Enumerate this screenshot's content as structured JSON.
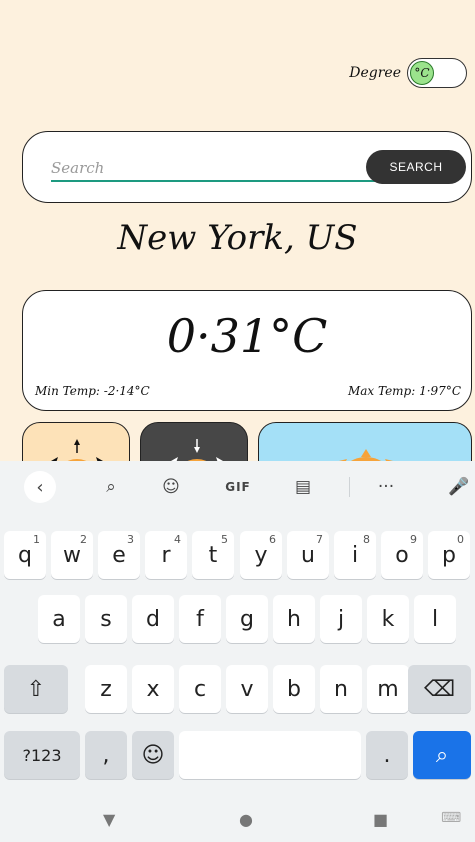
{
  "degree": {
    "label": "Degree",
    "unit": "°C"
  },
  "search": {
    "placeholder": "Search",
    "value": "",
    "button": "SEARCH"
  },
  "city": "New York, US",
  "temperature": {
    "current": "0·31°C",
    "min": "Min Temp: -2·14°C",
    "max": "Max Temp: 1·97°C"
  },
  "keyboard": {
    "toolbar": {
      "back": "‹",
      "search": "⌕",
      "sticker": "☺",
      "gif": "GIF",
      "clipboard": "▤",
      "more": "···",
      "mic": "🎤"
    },
    "row1": [
      {
        "k": "q",
        "h": "1"
      },
      {
        "k": "w",
        "h": "2"
      },
      {
        "k": "e",
        "h": "3"
      },
      {
        "k": "r",
        "h": "4"
      },
      {
        "k": "t",
        "h": "5"
      },
      {
        "k": "y",
        "h": "6"
      },
      {
        "k": "u",
        "h": "7"
      },
      {
        "k": "i",
        "h": "8"
      },
      {
        "k": "o",
        "h": "9"
      },
      {
        "k": "p",
        "h": "0"
      }
    ],
    "row2": [
      "a",
      "s",
      "d",
      "f",
      "g",
      "h",
      "j",
      "k",
      "l"
    ],
    "row3": [
      "z",
      "x",
      "c",
      "v",
      "b",
      "n",
      "m"
    ],
    "shift": "⇧",
    "backspace": "⌫",
    "symbols": "?123",
    "comma": ",",
    "emoji": "☺",
    "period": ".",
    "enter": "⌕"
  },
  "nav": {
    "back": "▼",
    "home": "●",
    "recents": "■",
    "keyboard": "⌨"
  }
}
